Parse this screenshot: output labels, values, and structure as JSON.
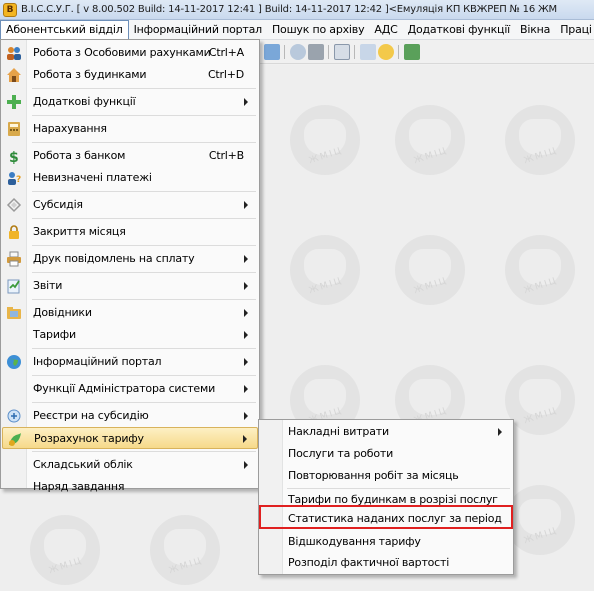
{
  "window": {
    "title": "В.І.С.С.У.Г. [ v 8.00.502 Build: 14-11-2017 12:41 ]  Build: 14-11-2017 12:42 ]<Емуляція КП КВЖРЕП № 16 ЖМ",
    "app_icon_letter": "В"
  },
  "menubar": {
    "items": [
      "Абонентський відділ",
      "Інформаційний портал",
      "Пошук по архіву",
      "АДС",
      "Додаткові функції",
      "Вікна",
      "Праці"
    ]
  },
  "watermark": {
    "text": "ЖМІЦ"
  },
  "main_menu": {
    "items": [
      {
        "label": "Робота з Особовими рахунками",
        "shortcut": "Ctrl+A",
        "icon": "people-icon"
      },
      {
        "label": "Робота з будинками",
        "shortcut": "Ctrl+D",
        "icon": "house-icon"
      },
      {
        "label": "Додаткові функції",
        "icon": "plus-icon"
      },
      {
        "label": "Нарахування",
        "icon": "calculator-icon"
      },
      {
        "label": "Робота з банком",
        "shortcut": "Ctrl+B",
        "icon": "dollar-icon"
      },
      {
        "label": "Невизначені платежі",
        "icon": "question-person-icon"
      },
      {
        "label": "Субсидія",
        "icon": "diamond-icon"
      },
      {
        "label": "Закриття місяця",
        "icon": "lock-icon"
      },
      {
        "label": "Друк повідомлень на сплату",
        "icon": "print-icon"
      },
      {
        "label": "Звіти",
        "icon": "report-icon"
      },
      {
        "label": "Довідники",
        "icon": "directory-icon"
      },
      {
        "label": "Тарифи"
      },
      {
        "label": "Інформаційний портал",
        "icon": "globe-icon"
      },
      {
        "label": "Функції Адміністратора системи"
      },
      {
        "label": "Реєстри на субсидію",
        "icon": "registry-icon"
      },
      {
        "label": "Розрахунок тарифу",
        "icon": "tariff-icon"
      },
      {
        "label": "Складський облік"
      },
      {
        "label": "Наряд завдання"
      }
    ]
  },
  "sub_menu": {
    "items": [
      {
        "label": "Накладні витрати"
      },
      {
        "label": "Послуги та роботи"
      },
      {
        "label": "Повторювання робіт за місяць"
      },
      {
        "label": "Тарифи по будинкам в розрізі послуг"
      },
      {
        "label": "Статистика наданих послуг за період"
      },
      {
        "label": "Відшкодування тарифу"
      },
      {
        "label": "Розподіл фактичної вартості"
      }
    ]
  },
  "colors": {
    "highlight": "#f6d98a",
    "callout_border": "#e02020"
  }
}
